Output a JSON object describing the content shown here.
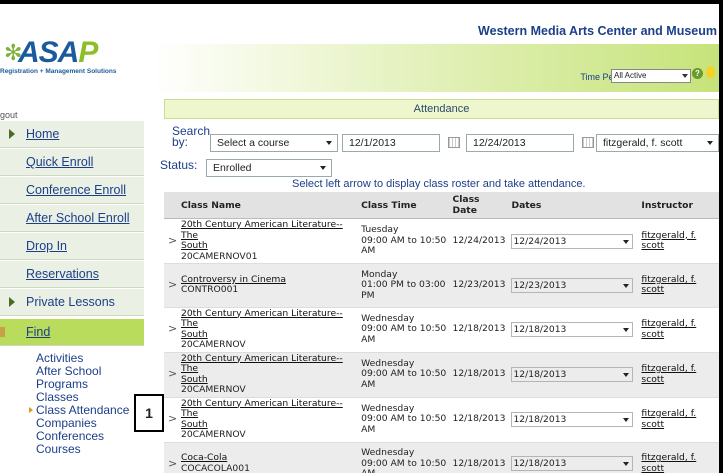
{
  "header": {
    "org_name": "Western Media Arts Center and Museum",
    "time_period_label": "Time Period:",
    "time_period_value": "All Active",
    "help_glyph": "?"
  },
  "logo": {
    "main_left": "ASA",
    "main_right": "P",
    "sub": "Registration + Management Solutions"
  },
  "sidebar": {
    "logout_label": "gout",
    "items": [
      {
        "label": "Home"
      },
      {
        "label": "Quick Enroll"
      },
      {
        "label": "Conference Enroll"
      },
      {
        "label": "After School Enroll"
      },
      {
        "label": "Drop In"
      },
      {
        "label": "Reservations"
      },
      {
        "label": "Private Lessons"
      },
      {
        "label": "Find"
      }
    ],
    "sub_items": [
      {
        "label": "Activities"
      },
      {
        "label": "After School Programs"
      },
      {
        "label": "Classes"
      },
      {
        "label": "Class Attendance"
      },
      {
        "label": "Companies"
      },
      {
        "label": "Conferences"
      },
      {
        "label": "Courses"
      }
    ]
  },
  "callout": {
    "number": "1"
  },
  "main": {
    "section_title": "Attendance",
    "search_by_label": "Search by:",
    "course_select": "Select a course",
    "start_date": "12/1/2013",
    "end_date": "12/24/2013",
    "instructor_select": "fitzgerald, f. scott",
    "status_label": "Status:",
    "status_value": "Enrolled",
    "hint": "Select left arrow to display class roster and take attendance."
  },
  "table": {
    "columns": [
      "Class Name",
      "Class Time",
      "Class Date",
      "Dates",
      "Instructor"
    ],
    "rows": [
      {
        "name_line1": "20th Century American Literature--The",
        "name_line2": "South",
        "code": "20CAMERNOV01",
        "day": "Tuesday",
        "time_line1": "09:00 AM to 10:50",
        "time_line2": "AM",
        "date": "12/24/2013",
        "dates_value": "12/24/2013",
        "instructor_line1": "fitzgerald, f.",
        "instructor_line2": "scott"
      },
      {
        "name_line1": "Controversy in Cinema",
        "name_line2": "",
        "code": "CONTRO001",
        "day": "Monday",
        "time_line1": "01:00 PM to 03:00",
        "time_line2": "PM",
        "date": "12/23/2013",
        "dates_value": "12/23/2013",
        "instructor_line1": "fitzgerald, f.",
        "instructor_line2": "scott"
      },
      {
        "name_line1": "20th Century American Literature--The",
        "name_line2": "South",
        "code": "20CAMERNOV",
        "day": "Wednesday",
        "time_line1": "09:00 AM to 10:50",
        "time_line2": "AM",
        "date": "12/18/2013",
        "dates_value": "12/18/2013",
        "instructor_line1": "fitzgerald, f.",
        "instructor_line2": "scott"
      },
      {
        "name_line1": "20th Century American Literature--The",
        "name_line2": "South",
        "code": "20CAMERNOV",
        "day": "Wednesday",
        "time_line1": "09:00 AM to 10:50",
        "time_line2": "AM",
        "date": "12/18/2013",
        "dates_value": "12/18/2013",
        "instructor_line1": "fitzgerald, f.",
        "instructor_line2": "scott"
      },
      {
        "name_line1": "20th Century American Literature--The",
        "name_line2": "South",
        "code": "20CAMERNOV",
        "day": "Wednesday",
        "time_line1": "09:00 AM to 10:50",
        "time_line2": "AM",
        "date": "12/18/2013",
        "dates_value": "12/18/2013",
        "instructor_line1": "fitzgerald, f.",
        "instructor_line2": "scott"
      },
      {
        "name_line1": "Coca-Cola",
        "name_line2": "",
        "code": "COCACOLA001",
        "day": "Wednesday",
        "time_line1": "09:00 AM to 10:50",
        "time_line2": "AM",
        "date": "12/18/2013",
        "dates_value": "12/18/2013",
        "instructor_line1": "fitzgerald, f.",
        "instructor_line2": "scott"
      }
    ]
  },
  "colors": {
    "accent_green": "#b9dc5d",
    "link_blue": "#1c3f8a",
    "callout_border": "#000000"
  },
  "icons": [
    "row-expand-icon",
    "calendar-icon",
    "help-icon",
    "lightbulb-icon",
    "dropdown-arrow-icon"
  ]
}
